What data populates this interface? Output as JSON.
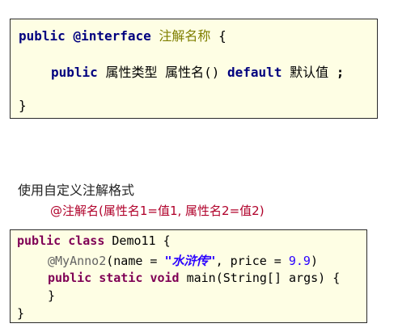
{
  "syntax": {
    "kw_public": "public",
    "kw_interface": "@interface",
    "annotation_name": "注解名称",
    "brace_open": "{",
    "attr_type": "属性类型",
    "attr_name": "属性名()",
    "kw_default": "default",
    "default_value": "默认值",
    "semicolon": ";",
    "brace_close": "}"
  },
  "usage": {
    "heading": "使用自定义注解格式",
    "format": "@注解名(属性名1=值1, 属性名2=值2)"
  },
  "example": {
    "kw_public": "public",
    "kw_class": "class",
    "class_name": "Demo11",
    "brace_open": "{",
    "annotation": "@MyAnno2",
    "param_open": "(name = ",
    "string_value": "\"水浒传\"",
    "param_mid": ", price = ",
    "number_value": "9.9",
    "param_close": ")",
    "kw_static": "static",
    "kw_void": "void",
    "method_sig": "main(String[] args) {",
    "inner_close": "}",
    "brace_close": "}"
  },
  "colors": {
    "box_background": "#fefee4",
    "keyword": "#00007f",
    "chinese_placeholder": "#7f7f00",
    "usage_format": "#b0002a",
    "example_keyword": "#7f0055",
    "example_string": "#2a00ff"
  }
}
